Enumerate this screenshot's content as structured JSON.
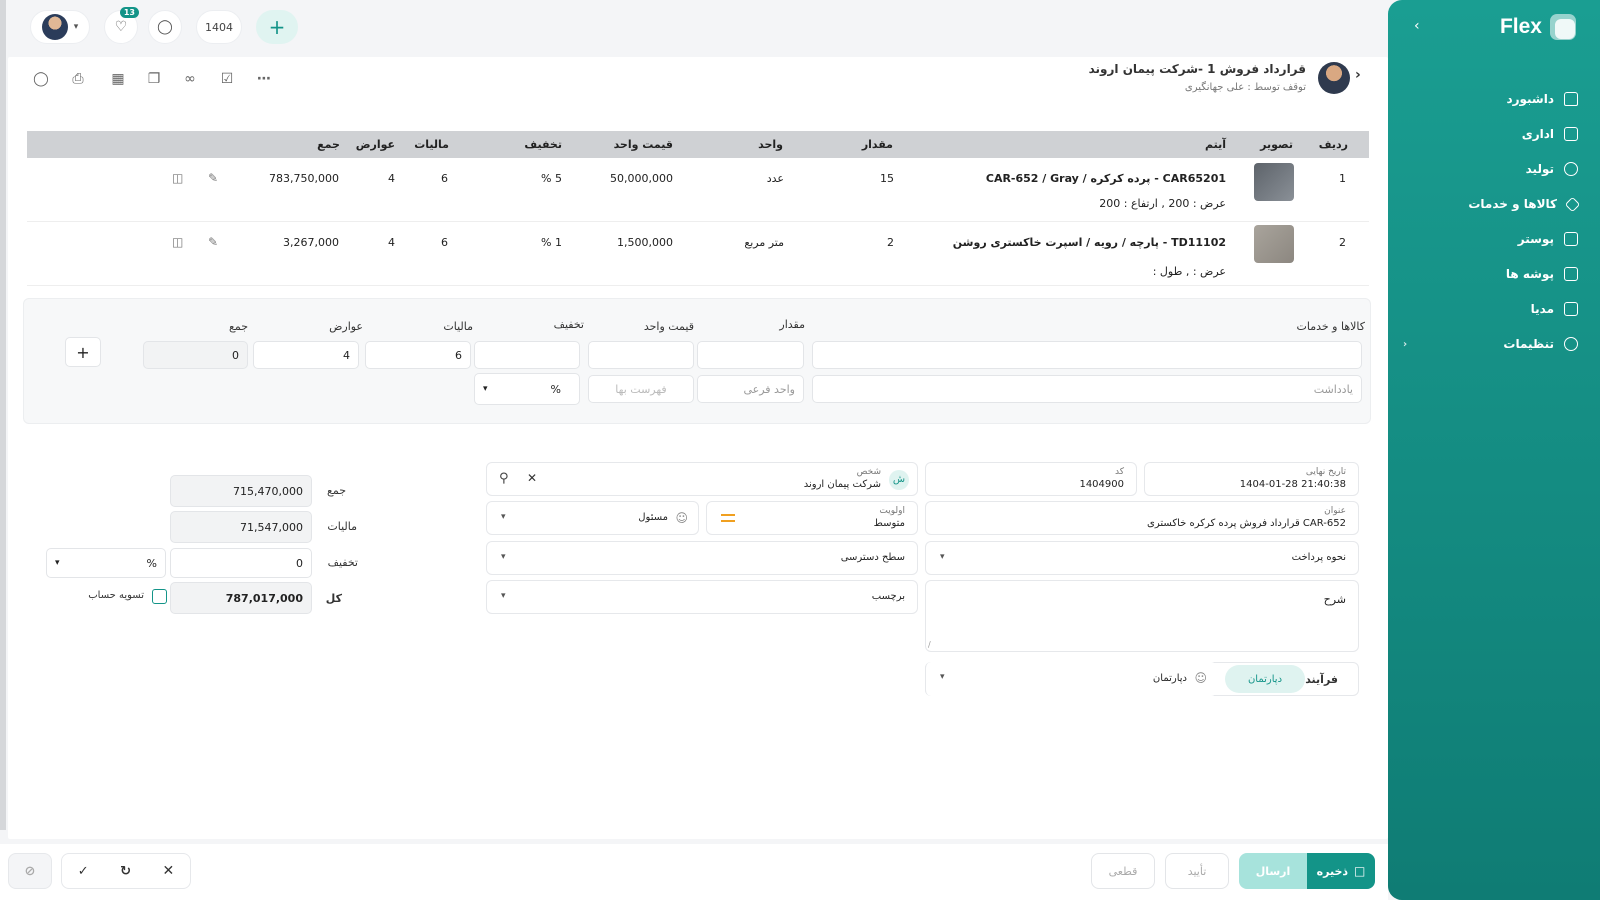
{
  "sidebar": {
    "brand": "Flex",
    "items": [
      {
        "label": "داشبورد"
      },
      {
        "label": "اداری"
      },
      {
        "label": "تولید"
      },
      {
        "label": "کالاها و خدمات"
      },
      {
        "label": "پوستر"
      },
      {
        "label": "پوشه ها"
      },
      {
        "label": "مدیا"
      },
      {
        "label": "تنظیمات"
      }
    ]
  },
  "topbar": {
    "notifications": "13",
    "year": "1404"
  },
  "header": {
    "title": "قرارداد فروش 1 -شرکت پیمان اروند",
    "subtitle": "توقف توسط : علی جهانگیری"
  },
  "table": {
    "headers": {
      "row": "ردیف",
      "image": "تصویر",
      "item": "آیتم",
      "qty": "مقدار",
      "unit": "واحد",
      "unit_price": "قیمت واحد",
      "discount": "تخفیف",
      "tax": "مالیات",
      "duties": "عوارض",
      "total": "جمع"
    },
    "rows": [
      {
        "row": "1",
        "item": "CAR65201  -  پرده کرکره / CAR-652 / Gray",
        "dims": "عرض : 200 ,  ارتفاع : 200",
        "qty": "15",
        "unit": "عدد",
        "unit_price": "50,000,000",
        "discount": "5 %",
        "tax": "6",
        "duties": "4",
        "total": "783,750,000"
      },
      {
        "row": "2",
        "item": "TD11102  -  پارچه / رویه / اسپرت خاکستری روشن",
        "dims": "عرض : ,  طول :",
        "qty": "2",
        "unit": "متر مربع",
        "unit_price": "1,500,000",
        "discount": "1 %",
        "tax": "6",
        "duties": "4",
        "total": "3,267,000"
      }
    ]
  },
  "entry": {
    "labels": {
      "goods": "کالاها و خدمات",
      "qty": "مقدار",
      "unit_price": "قیمت واحد",
      "discount": "تخفیف",
      "tax": "مالیات",
      "duties": "عوارض",
      "total": "جمع"
    },
    "tax": "6",
    "duties": "4",
    "total": "0",
    "note_placeholder": "یادداشت",
    "subunit_placeholder": "واحد فرعی",
    "pricelist_placeholder": "فهرست بها",
    "discount_type": "%"
  },
  "form": {
    "deadline_label": "تاریخ نهایی",
    "deadline": "1404-01-28 21:40:38",
    "code_label": "کد",
    "code": "1404900",
    "person_label": "شخص",
    "person": "شرکت پیمان اروند",
    "person_initial": "ش",
    "title_label": "عنوان",
    "title": "قرارداد فروش پرده کرکره خاکستری CAR-652",
    "priority_label": "اولویت",
    "priority": "متوسط",
    "responsible": "مسئول",
    "payment": "نحوه پرداخت",
    "access": "سطح دسترسی",
    "description": "شرح",
    "tag": "برچسب",
    "process": "فرآیند",
    "department_tab": "دپارتمان",
    "department": "دپارتمان"
  },
  "summary": {
    "sum_label": "جمع",
    "sum": "715,470,000",
    "tax_label": "مالیات",
    "tax": "71,547,000",
    "discount_label": "تخفیف",
    "discount": "0",
    "discount_type": "%",
    "grand_label": "کل",
    "grand": "787,017,000",
    "settle": "تسویه حساب"
  },
  "actions": {
    "save": "ذخیره",
    "send": "ارسال",
    "confirm": "تأیید",
    "final": "قطعی"
  },
  "colors": {
    "accent": "#139488",
    "accent_light": "#a7e3dc",
    "table_header": "#cfd1d4"
  }
}
